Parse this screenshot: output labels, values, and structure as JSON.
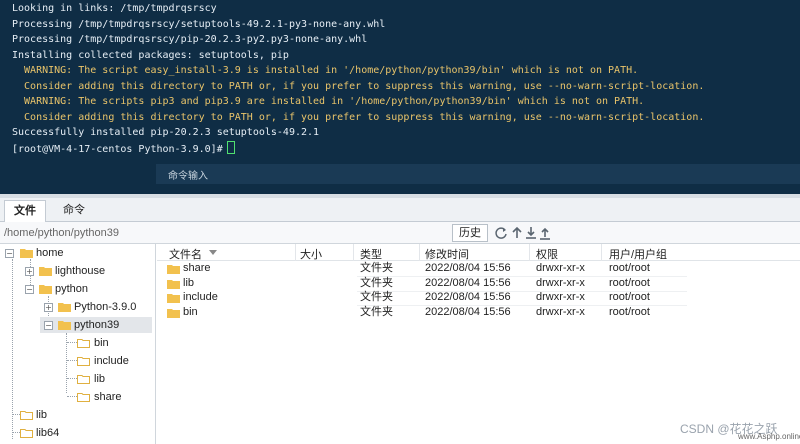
{
  "terminal": {
    "lines": [
      {
        "text": "Looking in links: /tmp/tmpdrqsrscy",
        "type": "normal"
      },
      {
        "text": "Processing /tmp/tmpdrqsrscy/setuptools-49.2.1-py3-none-any.whl",
        "type": "normal"
      },
      {
        "text": "Processing /tmp/tmpdrqsrscy/pip-20.2.3-py2.py3-none-any.whl",
        "type": "normal"
      },
      {
        "text": "Installing collected packages: setuptools, pip",
        "type": "normal"
      },
      {
        "text": "  WARNING: The script easy_install-3.9 is installed in '/home/python/python39/bin' which is not on PATH.",
        "type": "warn"
      },
      {
        "text": "  Consider adding this directory to PATH or, if you prefer to suppress this warning, use --no-warn-script-location.",
        "type": "warn"
      },
      {
        "text": "  WARNING: The scripts pip3 and pip3.9 are installed in '/home/python/python39/bin' which is not on PATH.",
        "type": "warn"
      },
      {
        "text": "  Consider adding this directory to PATH or, if you prefer to suppress this warning, use --no-warn-script-location.",
        "type": "warn"
      },
      {
        "text": "Successfully installed pip-20.2.3 setuptools-49.2.1",
        "type": "normal"
      }
    ],
    "prompt": "[root@VM-4-17-centos Python-3.9.0]#",
    "command_input_label": "命令输入"
  },
  "tabs": [
    {
      "label": "文件",
      "active": true
    },
    {
      "label": "命令",
      "active": false
    }
  ],
  "path_bar": {
    "path": "/home/python/python39",
    "history_button": "历史",
    "icons": [
      "refresh-icon",
      "up-icon",
      "download-icon",
      "upload-icon"
    ]
  },
  "tree": {
    "home": "home",
    "lighthouse": "lighthouse",
    "python": "python",
    "python390": "Python-3.9.0",
    "python39": "python39",
    "bin": "bin",
    "include": "include",
    "lib": "lib",
    "share": "share",
    "root_lib": "lib",
    "root_lib64": "lib64"
  },
  "file_list": {
    "columns": [
      "文件名",
      "大小",
      "类型",
      "修改时间",
      "权限",
      "用户/用户组"
    ],
    "rows": [
      {
        "name": "share",
        "size": "",
        "type": "文件夹",
        "mtime": "2022/08/04 15:56",
        "perm": "drwxr-xr-x",
        "owner": "root/root"
      },
      {
        "name": "lib",
        "size": "",
        "type": "文件夹",
        "mtime": "2022/08/04 15:56",
        "perm": "drwxr-xr-x",
        "owner": "root/root"
      },
      {
        "name": "include",
        "size": "",
        "type": "文件夹",
        "mtime": "2022/08/04 15:56",
        "perm": "drwxr-xr-x",
        "owner": "root/root"
      },
      {
        "name": "bin",
        "size": "",
        "type": "文件夹",
        "mtime": "2022/08/04 15:56",
        "perm": "drwxr-xr-x",
        "owner": "root/root"
      }
    ]
  },
  "watermark": "CSDN @花花之跃",
  "watermark_small": "www.Asphp.online",
  "colors": {
    "terminal_bg": "#0f2d45",
    "warning_text": "#e9c46a",
    "folder": "#f2c14e"
  }
}
